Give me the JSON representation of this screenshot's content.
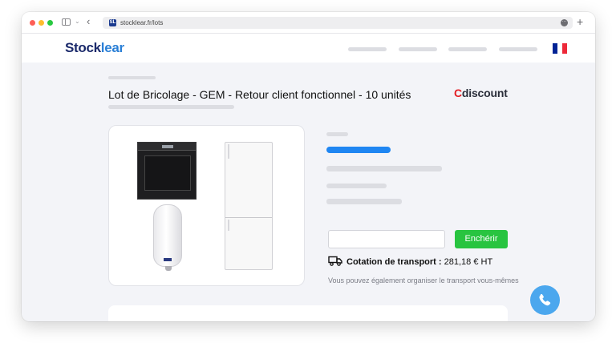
{
  "browser": {
    "url": "stocklear.fr/lots",
    "favicon_text": "SL"
  },
  "header": {
    "logo_part1": "Stock",
    "logo_part2": "lear",
    "flag_colors": [
      "#002395",
      "#ffffff",
      "#ed2939"
    ]
  },
  "lot": {
    "title": "Lot de Bricolage - GEM - Retour client fonctionnel - 10 unités",
    "brand_initial": "C",
    "brand_rest": "discount"
  },
  "bid": {
    "input_value": "",
    "button_label": "Enchérir"
  },
  "transport": {
    "label": "Cotation de transport :",
    "value": "281,18 € HT",
    "note": "Vous pouvez également organiser le transport vous-mêmes"
  },
  "colors": {
    "accent_blue": "#1f86f2",
    "bid_green": "#28c440",
    "phone_blue": "#4ba7ee"
  },
  "icons": [
    "sidebar-icon",
    "back-icon",
    "more-icon",
    "plus-icon",
    "truck-icon",
    "phone-icon"
  ]
}
